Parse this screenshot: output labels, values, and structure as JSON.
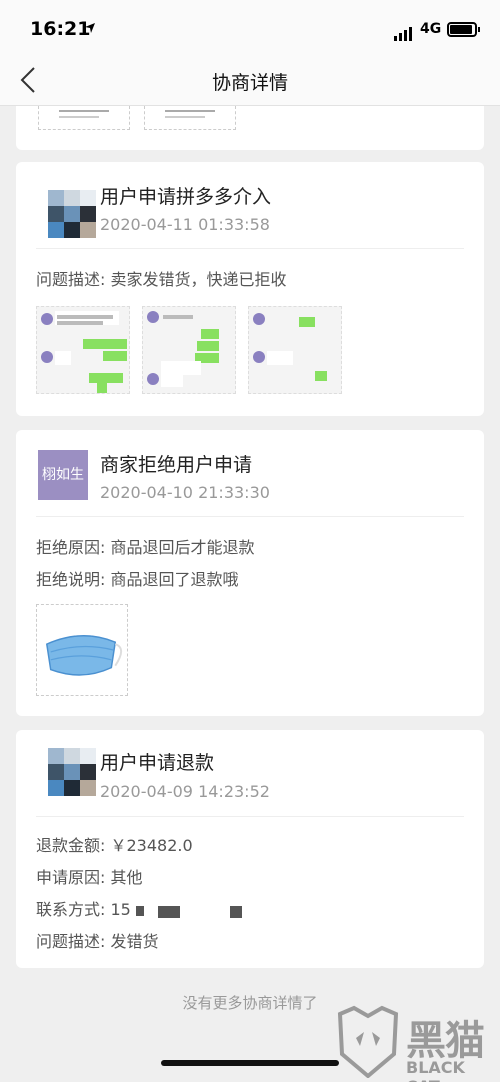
{
  "status_bar": {
    "time": "16:21",
    "network": "4G"
  },
  "nav": {
    "title": "协商详情"
  },
  "records": [
    {
      "title": "用户申请拼多多介入",
      "time": "2020-04-11 01:33:58",
      "details": [
        "问题描述: 卖家发错货，快递已拒收"
      ]
    },
    {
      "avatar_label": "栩如生",
      "title": "商家拒绝用户申请",
      "time": "2020-04-10 21:33:30",
      "details": [
        "拒绝原因: 商品退回后才能退款",
        "拒绝说明: 商品退回了退款哦"
      ]
    },
    {
      "title": "用户申请退款",
      "time": "2020-04-09 14:23:52",
      "details": [
        "退款金额: ￥23482.0",
        "申请原因: 其他",
        "联系方式: 15",
        "问题描述: 发错货"
      ]
    }
  ],
  "footer": {
    "note": "没有更多协商详情了"
  },
  "watermark": {
    "cn": "黑猫",
    "en": "BLACK CAT"
  },
  "colors": {
    "avatar_bg": "#9b8fc2",
    "chat_green": "#88e060"
  }
}
